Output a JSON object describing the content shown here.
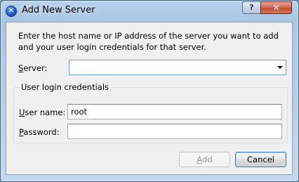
{
  "window": {
    "title": "Add New Server",
    "app_icon_glyph": "✕",
    "help_button": "?",
    "close_button": "✕"
  },
  "intro": {
    "line1": "Enter the host name or IP address of the server you want to add",
    "line2": "and your user login credentials for that server."
  },
  "server": {
    "label_mnemonic": "S",
    "label_rest": "erver:",
    "value": ""
  },
  "credentials": {
    "group_title": "User login credentials",
    "username_label_mnemonic": "U",
    "username_label_rest": "ser name:",
    "username_value": "root",
    "password_label_mnemonic": "P",
    "password_label_rest": "assword:",
    "password_value": ""
  },
  "buttons": {
    "add_mnemonic": "A",
    "add_rest": "dd",
    "add_enabled": false,
    "cancel_label": "Cancel"
  },
  "colors": {
    "titlebar": "#b9d1ea",
    "client_bg": "#f0f0f0",
    "close_button": "#c24a31",
    "focus_border": "#3c7fb1"
  }
}
